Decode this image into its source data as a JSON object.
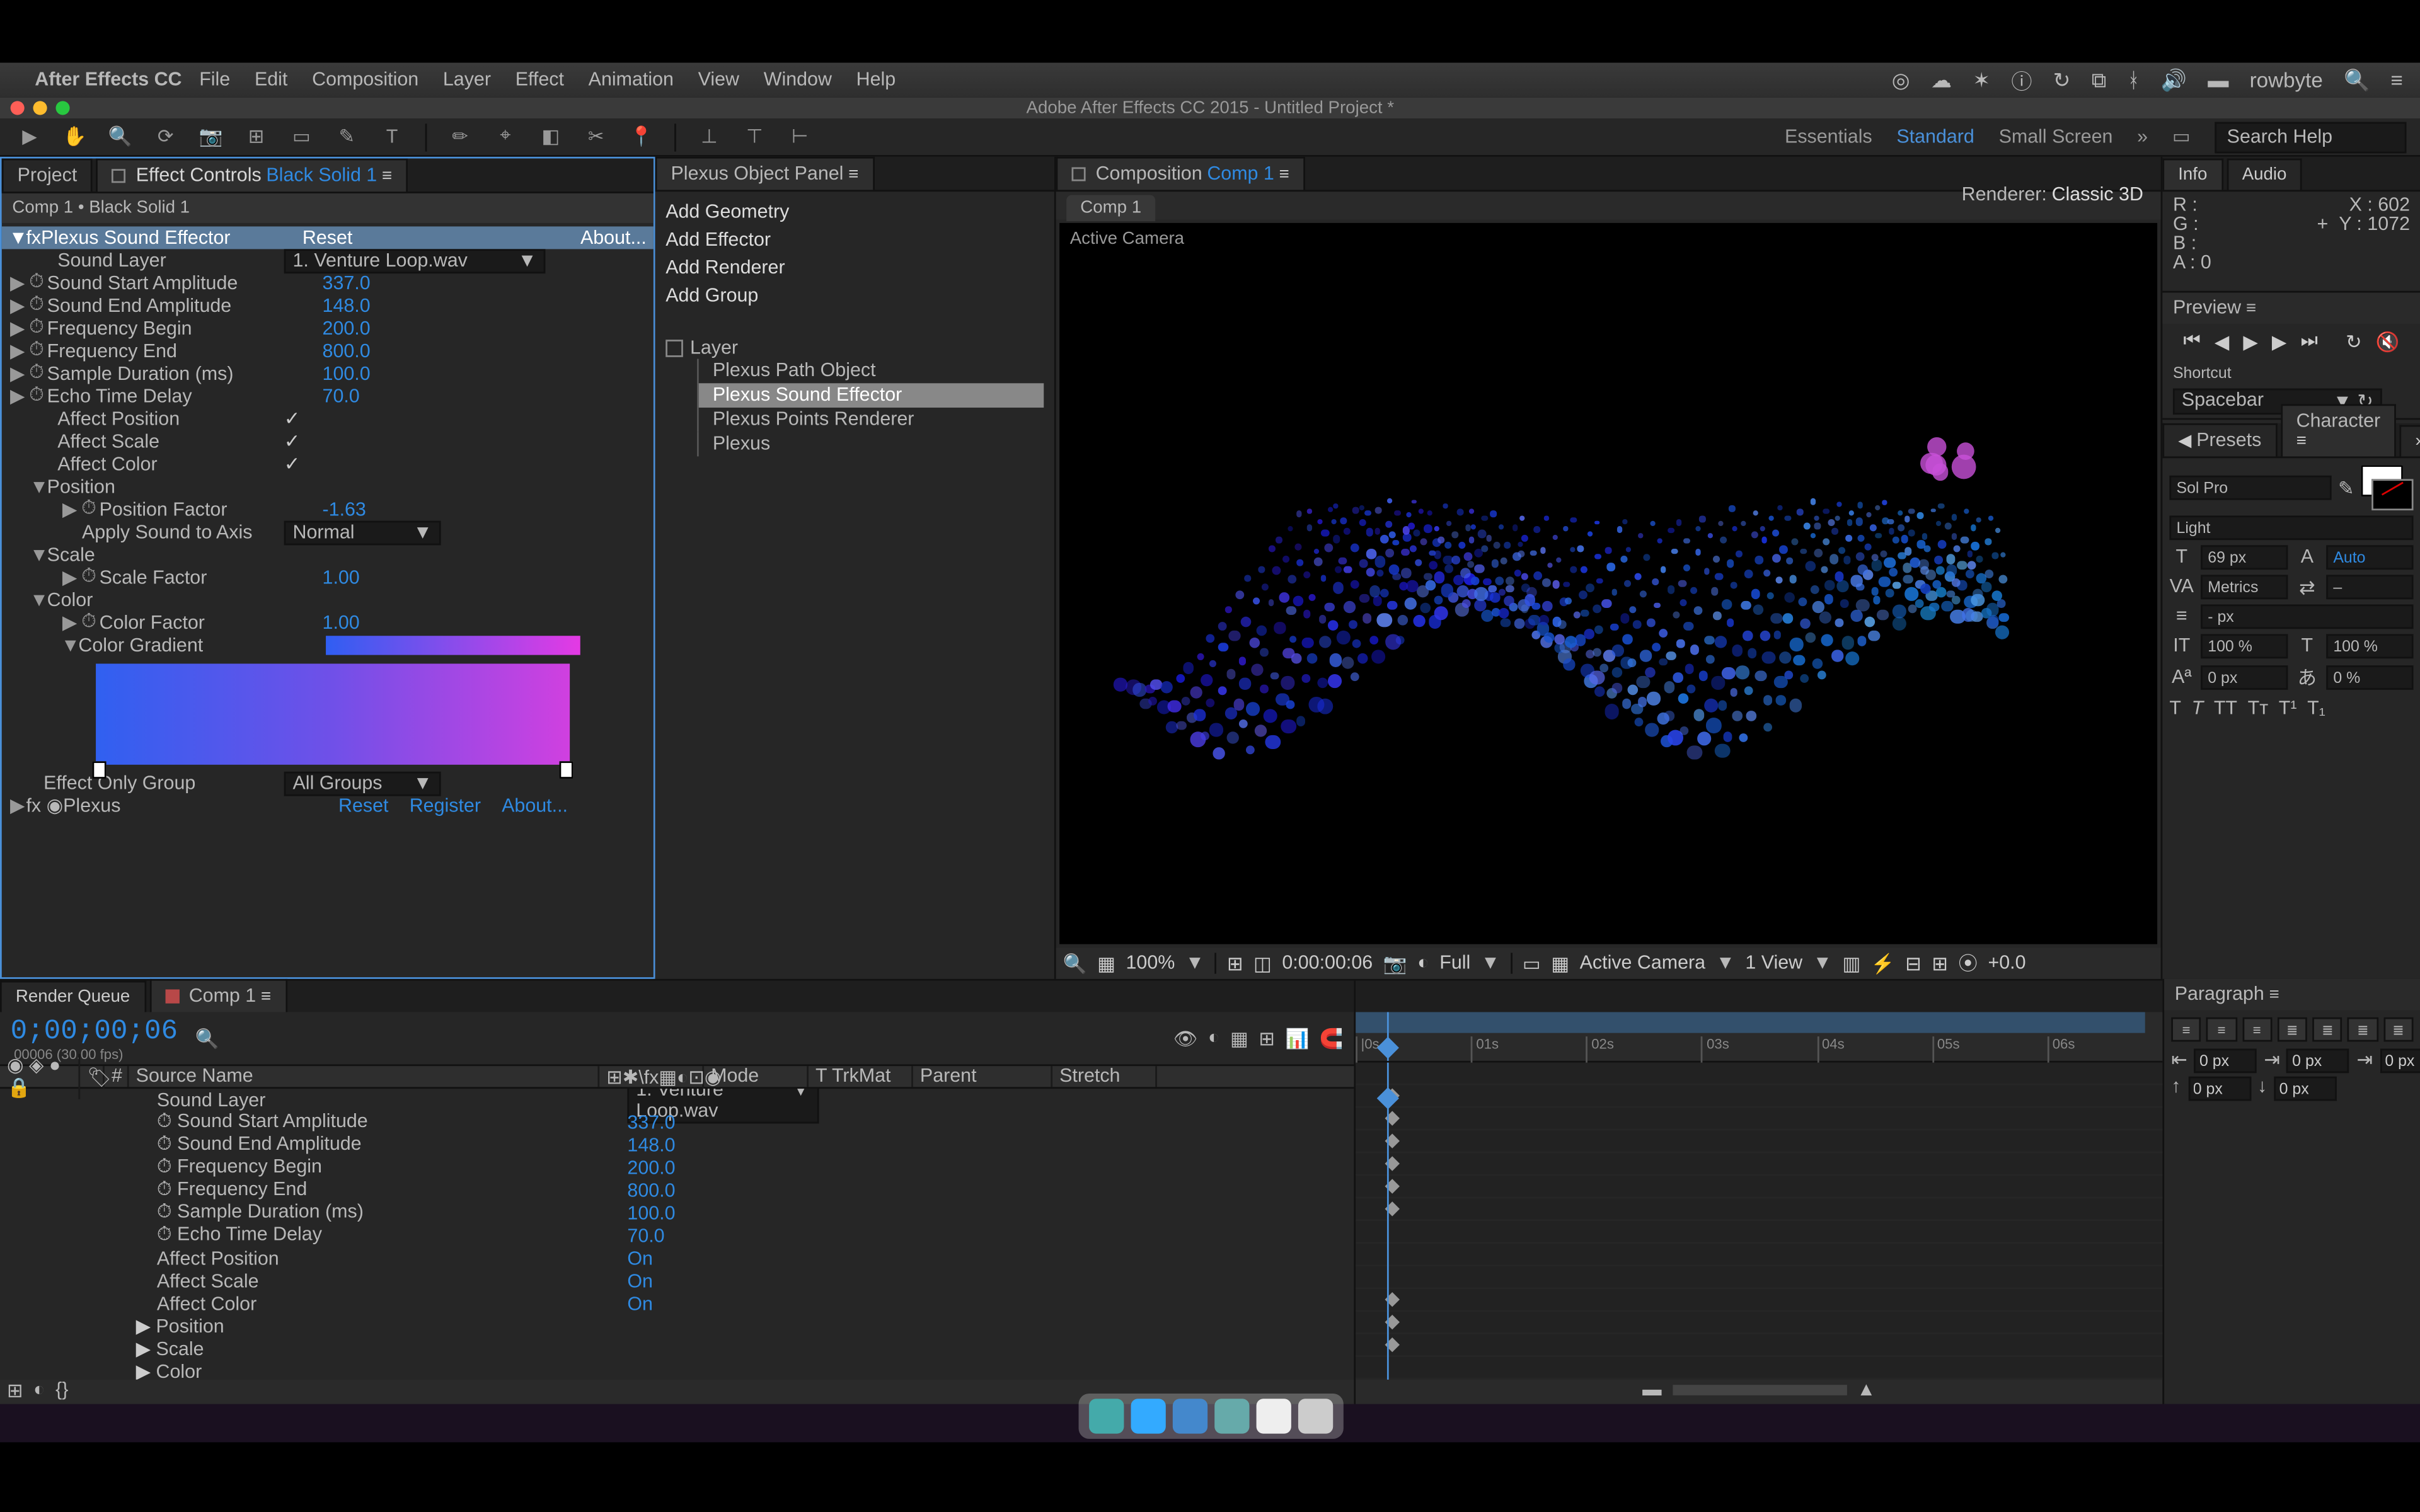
{
  "mac_menu": {
    "app": "After Effects CC",
    "items": [
      "File",
      "Edit",
      "Composition",
      "Layer",
      "Effect",
      "Animation",
      "View",
      "Window",
      "Help"
    ],
    "user": "rowbyte"
  },
  "window_title": "Adobe After Effects CC 2015 - Untitled Project *",
  "workspaces": {
    "items": [
      "Essentials",
      "Standard",
      "Small Screen"
    ],
    "search_ph": "Search Help"
  },
  "left_panel": {
    "tab_project": "Project",
    "tab_effect": "Effect Controls",
    "tab_layer": "Black Solid 1",
    "breadcrumb": "Comp 1 • Black Solid 1",
    "effect_name": "Plexus Sound Effector",
    "reset": "Reset",
    "about": "About...",
    "sound_layer_label": "Sound Layer",
    "sound_layer_val": "1. Venture Loop.wav",
    "props": [
      {
        "l": "Sound Start Amplitude",
        "v": "337.0"
      },
      {
        "l": "Sound End Amplitude",
        "v": "148.0"
      },
      {
        "l": "Frequency Begin",
        "v": "200.0"
      },
      {
        "l": "Frequency End",
        "v": "800.0"
      },
      {
        "l": "Sample Duration (ms)",
        "v": "100.0"
      },
      {
        "l": "Echo Time Delay",
        "v": "70.0"
      }
    ],
    "affects": [
      {
        "l": "Affect Position"
      },
      {
        "l": "Affect Scale"
      },
      {
        "l": "Affect Color"
      }
    ],
    "position_group": "Position",
    "position_factor_label": "Position Factor",
    "position_factor_val": "-1.63",
    "apply_axis_label": "Apply Sound to Axis",
    "apply_axis_val": "Normal",
    "scale_group": "Scale",
    "scale_factor_label": "Scale Factor",
    "scale_factor_val": "1.00",
    "color_group": "Color",
    "color_factor_label": "Color Factor",
    "color_factor_val": "1.00",
    "color_gradient_label": "Color Gradient",
    "effect_only_label": "Effect Only Group",
    "effect_only_val": "All Groups",
    "plexus_name": "Plexus",
    "register": "Register"
  },
  "plexus_panel": {
    "title": "Plexus Object Panel",
    "actions": [
      "Add Geometry",
      "Add Effector",
      "Add Renderer",
      "Add Group"
    ],
    "layer_label": "Layer",
    "children": [
      "Plexus Path Object",
      "Plexus Sound Effector",
      "Plexus Points Renderer",
      "Plexus"
    ]
  },
  "comp_panel": {
    "tab": "Composition",
    "comp_name": "Comp 1",
    "mini_tab": "Comp 1",
    "renderer_lbl": "Renderer:",
    "renderer_val": "Classic 3D",
    "active_camera": "Active Camera",
    "footer": {
      "zoom": "100%",
      "time": "0:00:00:06",
      "res": "Full",
      "cam": "Active Camera",
      "views": "1 View",
      "exposure": "+0.0"
    }
  },
  "info": {
    "r": "R :",
    "g": "G :",
    "b": "B :",
    "a": "A : 0",
    "x": "X : 602",
    "y": "Y : 1072"
  },
  "preview": {
    "title": "Preview",
    "shortcut_lbl": "Shortcut",
    "shortcut": "Spacebar"
  },
  "audio_tab": "Audio",
  "info_tab": "Info",
  "presets_tab": "Presets",
  "char_tab": "Character",
  "char": {
    "font": "Sol Pro",
    "style": "Light",
    "size": "69 px",
    "leading": "Auto",
    "kerning": "Metrics",
    "tracking": "–",
    "stroke": "- px",
    "vscale": "100 %",
    "hscale": "100 %",
    "baseline": "0 px",
    "tsume": "0 %"
  },
  "timeline": {
    "tab_rq": "Render Queue",
    "tab_comp": "Comp 1",
    "timecode": "0;00;00;06",
    "sub": "00006 (30.00 fps)",
    "col_src": "Source Name",
    "col_mode": "Mode",
    "col_trkmat": "T  TrkMat",
    "col_parent": "Parent",
    "col_stretch": "Stretch",
    "rows": [
      {
        "l": "Sound Layer",
        "v": "1. Venture Loop.wav",
        "dd": true
      },
      {
        "l": "Sound Start Amplitude",
        "v": "337.0"
      },
      {
        "l": "Sound End Amplitude",
        "v": "148.0"
      },
      {
        "l": "Frequency Begin",
        "v": "200.0"
      },
      {
        "l": "Frequency End",
        "v": "800.0"
      },
      {
        "l": "Sample Duration (ms)",
        "v": "100.0"
      },
      {
        "l": "Echo Time Delay",
        "v": "70.0"
      },
      {
        "l": "Affect Position",
        "v": "On"
      },
      {
        "l": "Affect Scale",
        "v": "On"
      },
      {
        "l": "Affect Color",
        "v": "On"
      }
    ],
    "groups": [
      "Position",
      "Scale",
      "Color"
    ],
    "effect_only": {
      "l": "Effect Only Group",
      "v": "All Groups"
    },
    "ruler": [
      "|0s",
      "01s",
      "02s",
      "03s",
      "04s",
      "05s",
      "06s"
    ]
  },
  "paragraph": {
    "title": "Paragraph",
    "indents": [
      "0 px",
      "0 px",
      "0 px"
    ],
    "spacing": [
      "0 px",
      "0 px"
    ]
  }
}
